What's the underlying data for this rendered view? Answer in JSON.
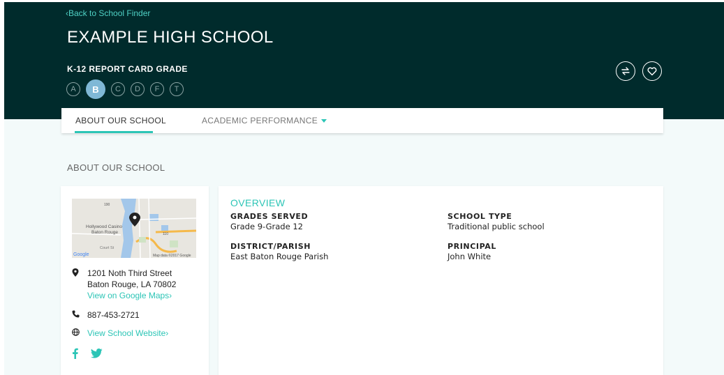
{
  "header": {
    "back_link": "‹Back to School Finder",
    "school_name": "EXAMPLE HIGH SCHOOL",
    "grade_label": "K-12 REPORT CARD GRADE",
    "grades": [
      "A",
      "B",
      "C",
      "D",
      "F",
      "T"
    ],
    "selected_grade": "B",
    "icons": [
      "compare-icon",
      "heart-icon"
    ]
  },
  "tabs": {
    "about": "ABOUT OUR SCHOOL",
    "academic": "ACADEMIC PERFORMANCE"
  },
  "section_title": "ABOUT OUR SCHOOL",
  "map": {
    "place_label_1": "Hollywood Casino",
    "place_label_2": "Baton Rouge",
    "street_label": "Court St",
    "attribution": "Map data ©2017 Google",
    "brand": "Google",
    "route_1": "190",
    "route_2": "110"
  },
  "contact": {
    "address_line1": "1201 Noth Third Street",
    "address_line2": "Baton Rouge, LA 70802",
    "maps_link": "View on Google Maps›",
    "phone": "887-453-2721",
    "website_link": "View School Website›"
  },
  "overview": {
    "title": "OVERVIEW",
    "grades_served_label": "GRADES SERVED",
    "grades_served_value": "Grade 9-Grade 12",
    "district_label": "DISTRICT/PARISH",
    "district_value": "East Baton Rouge Parish",
    "school_type_label": "SCHOOL TYPE",
    "school_type_value": "Traditional public school",
    "principal_label": "PRINCIPAL",
    "principal_value": "John White"
  },
  "colors": {
    "header_bg": "#002b2c",
    "accent": "#2cc5b6",
    "selected_grade": "#7fb8d6",
    "content_bg": "#f3fafa"
  }
}
